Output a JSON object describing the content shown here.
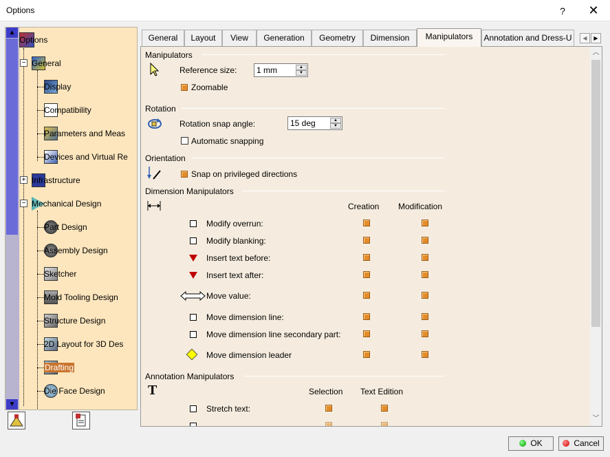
{
  "window": {
    "title": "Options",
    "help": "?",
    "close": "✕"
  },
  "tree": {
    "items": [
      {
        "label": "Options",
        "icon": "options-icon"
      },
      {
        "label": "General",
        "icon": "general-icon"
      },
      {
        "label": "Display",
        "icon": "display-icon"
      },
      {
        "label": "Compatibility",
        "icon": "compatibility-icon"
      },
      {
        "label": "Parameters and Meas",
        "icon": "parameters-icon"
      },
      {
        "label": "Devices and Virtual Re",
        "icon": "devices-icon"
      },
      {
        "label": "Infrastructure",
        "icon": "infrastructure-icon"
      },
      {
        "label": "Mechanical Design",
        "icon": "mechanical-design-icon"
      },
      {
        "label": "Part Design",
        "icon": "part-design-icon"
      },
      {
        "label": "Assembly Design",
        "icon": "assembly-design-icon"
      },
      {
        "label": "Sketcher",
        "icon": "sketcher-icon"
      },
      {
        "label": "Mold Tooling Design",
        "icon": "mold-tooling-icon"
      },
      {
        "label": "Structure Design",
        "icon": "structure-design-icon"
      },
      {
        "label": "2D Layout for 3D Des",
        "icon": "layout-2d-icon"
      },
      {
        "label": "Drafting",
        "icon": "drafting-icon",
        "selected": true
      },
      {
        "label": "Die Face Design",
        "icon": "die-face-icon"
      }
    ]
  },
  "tabs": [
    "General",
    "Layout",
    "View",
    "Generation",
    "Geometry",
    "Dimension",
    "Manipulators",
    "Annotation and Dress-U"
  ],
  "active_tab": "Manipulators",
  "manipulators": {
    "title": "Manipulators",
    "reference_size_label": "Reference size:",
    "reference_size_value": "1 mm",
    "zoomable_label": "Zoomable",
    "zoomable_checked": true
  },
  "rotation": {
    "title": "Rotation",
    "snap_angle_label": "Rotation snap angle:",
    "snap_angle_value": "15 deg",
    "auto_snapping_label": "Automatic snapping",
    "auto_snapping_checked": false
  },
  "orientation": {
    "title": "Orientation",
    "snap_label": "Snap on privileged directions",
    "snap_checked": true
  },
  "dimension_manipulators": {
    "title": "Dimension Manipulators",
    "col_creation": "Creation",
    "col_modification": "Modification",
    "rows": [
      {
        "label": "Modify overrun:",
        "symbol": "square"
      },
      {
        "label": "Modify blanking:",
        "symbol": "square"
      },
      {
        "label": "Insert text before:",
        "symbol": "red-triangle"
      },
      {
        "label": "Insert text after:",
        "symbol": "red-triangle"
      },
      {
        "label": "Move value:",
        "symbol": "double-arrow"
      },
      {
        "label": "Move dimension line:",
        "symbol": "square"
      },
      {
        "label": "Move dimension line secondary part:",
        "symbol": "square"
      },
      {
        "label": "Move dimension leader",
        "symbol": "yellow-diamond"
      }
    ]
  },
  "annotation_manipulators": {
    "title": "Annotation Manipulators",
    "col_selection": "Selection",
    "col_text_edition": "Text Edition",
    "rows": [
      {
        "label": "Stretch text:",
        "symbol": "square"
      }
    ]
  },
  "buttons": {
    "ok": "OK",
    "cancel": "Cancel"
  },
  "colors": {
    "tree_bg": "#fde6bd",
    "panel_bg": "#f5ecdf",
    "checkbox_on": "#e38c2a",
    "selection": "#c8742c"
  }
}
